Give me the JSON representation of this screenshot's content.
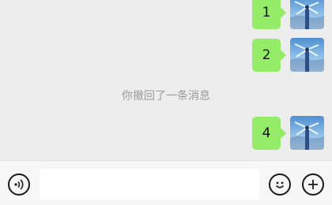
{
  "messages": [
    {
      "text": "1"
    },
    {
      "text": "2"
    },
    {
      "text": "4"
    }
  ],
  "system_notice": "你撤回了一条消息",
  "toolbar": {
    "voice_icon": "voice-icon",
    "input_value": "",
    "emoji_icon": "emoji-icon",
    "more_icon": "plus-icon"
  },
  "colors": {
    "chat_bg": "#ededed",
    "bubble": "#95ec69",
    "toolbar_bg": "#f6f6f6"
  }
}
